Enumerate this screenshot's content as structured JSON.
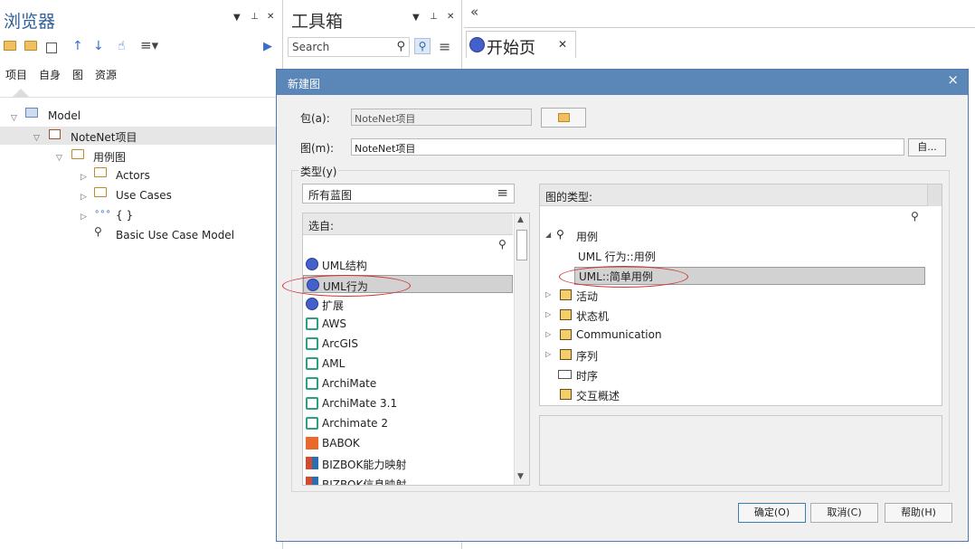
{
  "browser": {
    "title": "浏览器",
    "tabs": [
      "项目",
      "自身",
      "图",
      "资源"
    ],
    "tree": [
      {
        "label": "Model"
      },
      {
        "label": "NoteNet项目"
      },
      {
        "label": "用例图"
      },
      {
        "label": "Actors"
      },
      {
        "label": "Use Cases"
      },
      {
        "label": "{ }"
      },
      {
        "label": "Basic Use Case Model"
      }
    ]
  },
  "toolbox": {
    "title": "工具箱",
    "search_placeholder": "Search"
  },
  "start_tab": {
    "label": "开始页",
    "collapse_glyph": "«"
  },
  "dialog": {
    "title": "新建图",
    "package_label": "包(a):",
    "package_value": "NoteNet项目",
    "diagram_label": "图(m):",
    "diagram_value": "NoteNet项目",
    "auto_button": "自...",
    "type_group_label": "类型(y)",
    "blueprint_select": "所有蓝图",
    "select_from_header": "选自:",
    "left_items": [
      {
        "label": "UML结构",
        "icon": "uml"
      },
      {
        "label": "UML行为",
        "icon": "uml",
        "selected": true
      },
      {
        "label": "扩展",
        "icon": "uml"
      },
      {
        "label": "AWS",
        "icon": "aws"
      },
      {
        "label": "ArcGIS",
        "icon": "aws"
      },
      {
        "label": "AML",
        "icon": "aws"
      },
      {
        "label": "ArchiMate",
        "icon": "aws"
      },
      {
        "label": "ArchiMate 3.1",
        "icon": "aws"
      },
      {
        "label": "Archimate 2",
        "icon": "aws"
      },
      {
        "label": "BABOK",
        "icon": "babok"
      },
      {
        "label": "BIZBOK能力映射",
        "icon": "bizbok"
      },
      {
        "label": "BIZBOK信息映射",
        "icon": "bizbok"
      }
    ],
    "diagram_types_header": "图的类型:",
    "right_items": [
      {
        "label": "用例",
        "expanded": true
      },
      {
        "label": "UML 行为::用例",
        "child": true
      },
      {
        "label": "UML::简单用例",
        "child": true,
        "selected": true
      },
      {
        "label": "活动"
      },
      {
        "label": "状态机"
      },
      {
        "label": "Communication"
      },
      {
        "label": "序列"
      },
      {
        "label": "时序"
      },
      {
        "label": "交互概述"
      }
    ],
    "ok_button": "确定(O)",
    "cancel_button": "取消(C)",
    "help_button": "帮助(H)"
  },
  "colors": {
    "title_bar": "#5b86b8",
    "panel_title": "#2f5f9a",
    "selection": "#d2d2d2",
    "annotation": "#d43030"
  }
}
